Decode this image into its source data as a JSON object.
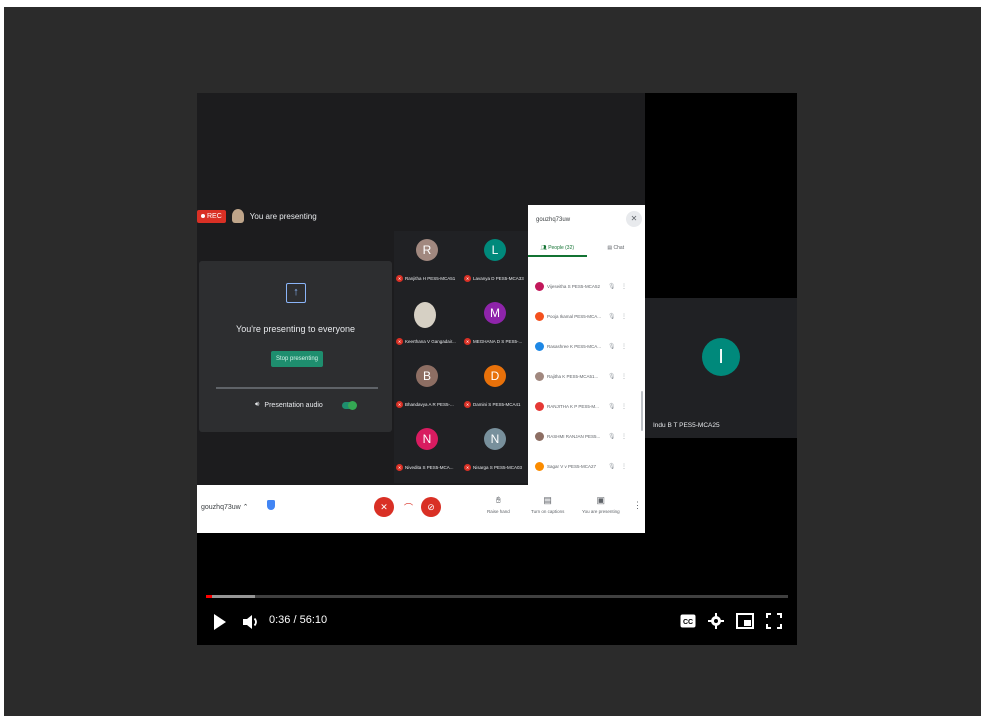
{
  "meet": {
    "rec_label": "REC",
    "presenting_header": "You are presenting",
    "present_card": {
      "title": "You're presenting to everyone",
      "stop_label": "Stop presenting",
      "audio_label": "Presentation audio"
    },
    "grid": [
      {
        "initial": "R",
        "color": "#a1887f",
        "name": "Ranjitha H PES5-MCA51"
      },
      {
        "initial": "L",
        "color": "#00897b",
        "name": "Lavanya D PES5-MCA33"
      },
      {
        "initial": "",
        "color": "",
        "name": "Keerthana V Gangadair...",
        "photo": true
      },
      {
        "initial": "M",
        "color": "#8e24aa",
        "name": "MEGHANA D S PES5-..."
      },
      {
        "initial": "B",
        "color": "#8d6e63",
        "name": "Bhandavya A R PES5-..."
      },
      {
        "initial": "D",
        "color": "#e8710a",
        "name": "Damini S PES5-MCA41"
      },
      {
        "initial": "N",
        "color": "#d81b60",
        "name": "Nivedita S PES5-MCA..."
      },
      {
        "initial": "N",
        "color": "#78909c",
        "name": "Nisarga S PES5-MCA03"
      }
    ],
    "people_panel": {
      "code": "gouzhq73uw",
      "tab_people": "People (32)",
      "tab_chat": "Chat",
      "list": [
        {
          "name": "Vijeseitha S PES5-MCA52",
          "color": "#c2185b"
        },
        {
          "name": "Pooja Ikamal PES5-MCA...",
          "color": "#f4511e"
        },
        {
          "name": "Rasashree K PES5-MCA...",
          "color": "#1e88e5"
        },
        {
          "name": "Rajitha K PES5-MCA51...",
          "color": "#a1887f"
        },
        {
          "name": "RANJITHA K P PES5-M...",
          "color": "#e53935"
        },
        {
          "name": "RASHMI RANJAN PES5...",
          "color": "#8d6e63"
        },
        {
          "name": "Sagar V v PES5-MCA27",
          "color": "#fb8c00"
        }
      ]
    },
    "bottom_bar": {
      "code": "gouzhq73uw",
      "raise_hand": "Raise hand",
      "captions": "Turn on captions",
      "presenting": "You are presenting"
    },
    "right_tile": {
      "initial": "I",
      "name": "Indu B T PES5-MCA25"
    }
  },
  "player": {
    "time_current": "0:36",
    "time_total": "56:10",
    "progress_played": 0.011,
    "progress_buffered": 0.085
  }
}
